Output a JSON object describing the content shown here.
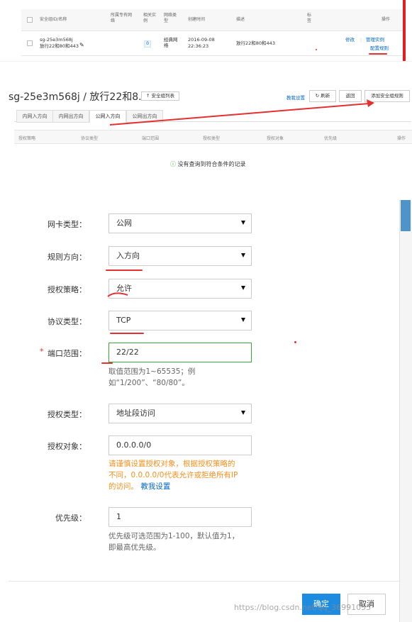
{
  "group_table": {
    "columns": [
      "安全组ID/名称",
      "所属专有网络",
      "相关实例",
      "网络类型",
      "创建时间",
      "描述",
      "标签",
      "操作"
    ],
    "row": {
      "id": "sg-25e3m568j",
      "name": "放行22和80和443",
      "instances": "0",
      "network_type": "经典网络",
      "created_date": "2016-09-08",
      "created_time": "22:36:23",
      "description": "放行22和80和443",
      "actions": [
        "修改",
        "管理实例",
        "配置规则"
      ]
    }
  },
  "rules_panel": {
    "title": "sg-25e3m568j / 放行22和8...",
    "back_button": "安全组列表",
    "help_link": "教我设置",
    "refresh_button": "刷新",
    "return_button": "返回",
    "add_button": "添加安全组规则",
    "tabs": [
      "内网入方向",
      "内网出方向",
      "公网入方向",
      "公网出方向"
    ],
    "active_tab": 2,
    "columns": [
      "授权策略",
      "协议类型",
      "端口范围",
      "授权类型",
      "授权对象",
      "优先级",
      "操作"
    ],
    "empty_text": "没有查询到符合条件的记录"
  },
  "form": {
    "nic_type": {
      "label": "网卡类型：",
      "value": "公网"
    },
    "direction": {
      "label": "规则方向：",
      "value": "入方向"
    },
    "policy": {
      "label": "授权策略：",
      "value": "允许"
    },
    "protocol": {
      "label": "协议类型：",
      "value": "TCP"
    },
    "port_range": {
      "label": "端口范围：",
      "value": "22/22",
      "required_mark": "*",
      "help_line1": "取值范围为1~65535；例",
      "help_line2": "如“1/200”、“80/80”。"
    },
    "auth_type": {
      "label": "授权类型：",
      "value": "地址段访问"
    },
    "auth_object": {
      "label": "授权对象：",
      "value": "0.0.0.0/0",
      "warn_line1": "请谨慎设置授权对象，根据授权策略的",
      "warn_line2": "不同，0.0.0.0/0代表允许或拒绝所有IP",
      "warn_line3": "的访问。",
      "help_link": "教我设置"
    },
    "priority": {
      "label": "优先级：",
      "value": "1",
      "help_line1": "优先级可选范围为1-100，默认值为1，",
      "help_line2": "即最高优先级。"
    },
    "confirm_button": "确定",
    "cancel_button": "取消"
  },
  "watermark": "https://blog.csdn.net/qq_36991055",
  "colors": {
    "accent": "#1d8be0",
    "annotation_red": "#e53030",
    "focus_green": "#3aa83a",
    "warn": "#f5901e",
    "link": "#0066cc"
  }
}
